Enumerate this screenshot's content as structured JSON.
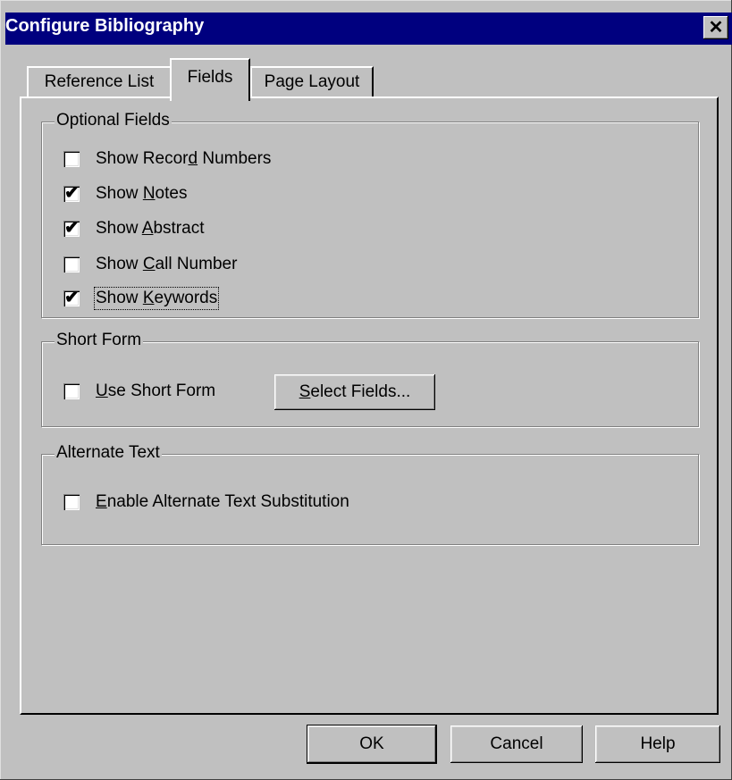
{
  "window": {
    "title": "Configure Bibliography",
    "close_glyph": "✕"
  },
  "tabs": [
    {
      "label": "Reference List",
      "active": false
    },
    {
      "label": "Fields",
      "active": true
    },
    {
      "label": "Page Layout",
      "active": false
    }
  ],
  "optional_fields": {
    "legend": "Optional Fields",
    "items": [
      {
        "pre": "Show Recor",
        "key": "d",
        "post": " Numbers",
        "checked": false
      },
      {
        "pre": "Show ",
        "key": "N",
        "post": "otes",
        "checked": true
      },
      {
        "pre": "Show ",
        "key": "A",
        "post": "bstract",
        "checked": true
      },
      {
        "pre": "Show ",
        "key": "C",
        "post": "all Number",
        "checked": false
      },
      {
        "pre": "Show ",
        "key": "K",
        "post": "eywords",
        "checked": true
      }
    ]
  },
  "short_form": {
    "legend": "Short Form",
    "checkbox": {
      "pre": "",
      "key": "U",
      "post": "se Short Form",
      "checked": false
    },
    "button": {
      "pre": "",
      "key": "S",
      "post": "elect Fields..."
    }
  },
  "alternate_text": {
    "legend": "Alternate Text",
    "checkbox": {
      "pre": "",
      "key": "E",
      "post": "nable Alternate Text Substitution",
      "checked": false
    }
  },
  "footer": {
    "ok": "OK",
    "cancel": "Cancel",
    "help": "Help"
  },
  "check_glyph": "✔"
}
